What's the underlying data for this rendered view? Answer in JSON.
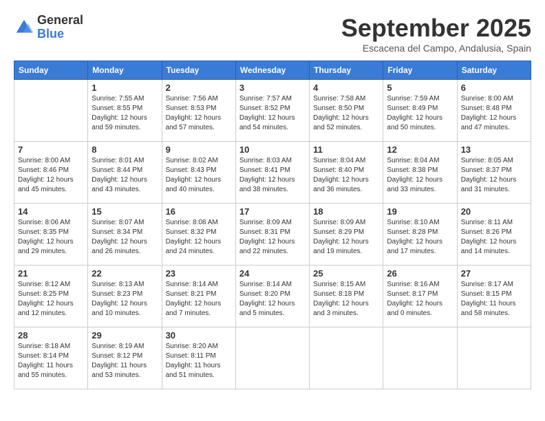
{
  "logo": {
    "general": "General",
    "blue": "Blue"
  },
  "title": "September 2025",
  "subtitle": "Escacena del Campo, Andalusia, Spain",
  "headers": [
    "Sunday",
    "Monday",
    "Tuesday",
    "Wednesday",
    "Thursday",
    "Friday",
    "Saturday"
  ],
  "weeks": [
    [
      {
        "day": "",
        "info": ""
      },
      {
        "day": "1",
        "info": "Sunrise: 7:55 AM\nSunset: 8:55 PM\nDaylight: 12 hours\nand 59 minutes."
      },
      {
        "day": "2",
        "info": "Sunrise: 7:56 AM\nSunset: 8:53 PM\nDaylight: 12 hours\nand 57 minutes."
      },
      {
        "day": "3",
        "info": "Sunrise: 7:57 AM\nSunset: 8:52 PM\nDaylight: 12 hours\nand 54 minutes."
      },
      {
        "day": "4",
        "info": "Sunrise: 7:58 AM\nSunset: 8:50 PM\nDaylight: 12 hours\nand 52 minutes."
      },
      {
        "day": "5",
        "info": "Sunrise: 7:59 AM\nSunset: 8:49 PM\nDaylight: 12 hours\nand 50 minutes."
      },
      {
        "day": "6",
        "info": "Sunrise: 8:00 AM\nSunset: 8:48 PM\nDaylight: 12 hours\nand 47 minutes."
      }
    ],
    [
      {
        "day": "7",
        "info": "Sunrise: 8:00 AM\nSunset: 8:46 PM\nDaylight: 12 hours\nand 45 minutes."
      },
      {
        "day": "8",
        "info": "Sunrise: 8:01 AM\nSunset: 8:44 PM\nDaylight: 12 hours\nand 43 minutes."
      },
      {
        "day": "9",
        "info": "Sunrise: 8:02 AM\nSunset: 8:43 PM\nDaylight: 12 hours\nand 40 minutes."
      },
      {
        "day": "10",
        "info": "Sunrise: 8:03 AM\nSunset: 8:41 PM\nDaylight: 12 hours\nand 38 minutes."
      },
      {
        "day": "11",
        "info": "Sunrise: 8:04 AM\nSunset: 8:40 PM\nDaylight: 12 hours\nand 36 minutes."
      },
      {
        "day": "12",
        "info": "Sunrise: 8:04 AM\nSunset: 8:38 PM\nDaylight: 12 hours\nand 33 minutes."
      },
      {
        "day": "13",
        "info": "Sunrise: 8:05 AM\nSunset: 8:37 PM\nDaylight: 12 hours\nand 31 minutes."
      }
    ],
    [
      {
        "day": "14",
        "info": "Sunrise: 8:06 AM\nSunset: 8:35 PM\nDaylight: 12 hours\nand 29 minutes."
      },
      {
        "day": "15",
        "info": "Sunrise: 8:07 AM\nSunset: 8:34 PM\nDaylight: 12 hours\nand 26 minutes."
      },
      {
        "day": "16",
        "info": "Sunrise: 8:08 AM\nSunset: 8:32 PM\nDaylight: 12 hours\nand 24 minutes."
      },
      {
        "day": "17",
        "info": "Sunrise: 8:09 AM\nSunset: 8:31 PM\nDaylight: 12 hours\nand 22 minutes."
      },
      {
        "day": "18",
        "info": "Sunrise: 8:09 AM\nSunset: 8:29 PM\nDaylight: 12 hours\nand 19 minutes."
      },
      {
        "day": "19",
        "info": "Sunrise: 8:10 AM\nSunset: 8:28 PM\nDaylight: 12 hours\nand 17 minutes."
      },
      {
        "day": "20",
        "info": "Sunrise: 8:11 AM\nSunset: 8:26 PM\nDaylight: 12 hours\nand 14 minutes."
      }
    ],
    [
      {
        "day": "21",
        "info": "Sunrise: 8:12 AM\nSunset: 8:25 PM\nDaylight: 12 hours\nand 12 minutes."
      },
      {
        "day": "22",
        "info": "Sunrise: 8:13 AM\nSunset: 8:23 PM\nDaylight: 12 hours\nand 10 minutes."
      },
      {
        "day": "23",
        "info": "Sunrise: 8:14 AM\nSunset: 8:21 PM\nDaylight: 12 hours\nand 7 minutes."
      },
      {
        "day": "24",
        "info": "Sunrise: 8:14 AM\nSunset: 8:20 PM\nDaylight: 12 hours\nand 5 minutes."
      },
      {
        "day": "25",
        "info": "Sunrise: 8:15 AM\nSunset: 8:18 PM\nDaylight: 12 hours\nand 3 minutes."
      },
      {
        "day": "26",
        "info": "Sunrise: 8:16 AM\nSunset: 8:17 PM\nDaylight: 12 hours\nand 0 minutes."
      },
      {
        "day": "27",
        "info": "Sunrise: 8:17 AM\nSunset: 8:15 PM\nDaylight: 11 hours\nand 58 minutes."
      }
    ],
    [
      {
        "day": "28",
        "info": "Sunrise: 8:18 AM\nSunset: 8:14 PM\nDaylight: 11 hours\nand 55 minutes."
      },
      {
        "day": "29",
        "info": "Sunrise: 8:19 AM\nSunset: 8:12 PM\nDaylight: 11 hours\nand 53 minutes."
      },
      {
        "day": "30",
        "info": "Sunrise: 8:20 AM\nSunset: 8:11 PM\nDaylight: 11 hours\nand 51 minutes."
      },
      {
        "day": "",
        "info": ""
      },
      {
        "day": "",
        "info": ""
      },
      {
        "day": "",
        "info": ""
      },
      {
        "day": "",
        "info": ""
      }
    ]
  ]
}
